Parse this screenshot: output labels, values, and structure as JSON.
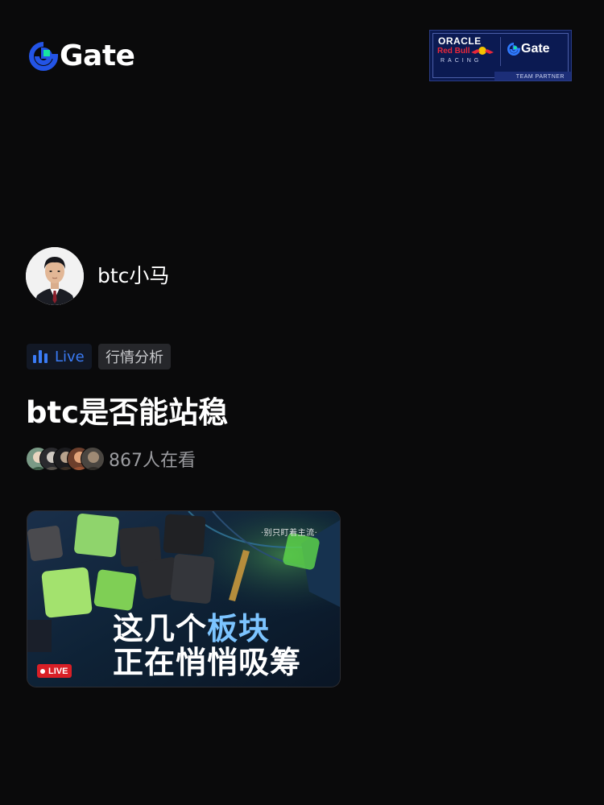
{
  "brand": {
    "logo_text": "Gate",
    "logo_icon": "gate-logo-icon",
    "accent": "#17e5a0",
    "primary": "#2354e6"
  },
  "partner_badge": {
    "oracle": "ORACLE",
    "redbull": "Red Bull",
    "racing": "RACING",
    "gate": "Gate",
    "caption": "TEAM PARTNER"
  },
  "host": {
    "name": "btc小马"
  },
  "tags": {
    "live_label": "Live",
    "category": "行情分析",
    "live_color": "#3a7bf5"
  },
  "stream": {
    "title": "btc是否能站稳",
    "viewer_count": "867人在看"
  },
  "cover": {
    "tagline": "·别只盯着主流·",
    "line1_white": "这几个",
    "line1_blue": "板块",
    "line2": "正在悄悄吸筹",
    "live_badge": "LIVE"
  }
}
